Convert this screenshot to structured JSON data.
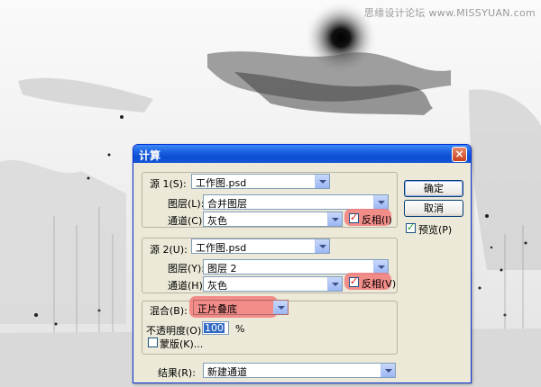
{
  "watermark": "思缘设计论坛 www.MISSYUAN.com",
  "dialog": {
    "title": "计算",
    "close_symbol": "×",
    "source1": {
      "label": "源 1(S):",
      "file": "工作图.psd",
      "layer_label": "图层(L):",
      "layer_value": "合并图层",
      "channel_label": "通道(C):",
      "channel_value": "灰色",
      "invert_label": "反相(I)",
      "invert_checked": true
    },
    "source2": {
      "label": "源 2(U):",
      "file": "工作图.psd",
      "layer_label": "图层(Y):",
      "layer_value": "图层 2",
      "channel_label": "通道(H):",
      "channel_value": "灰色",
      "invert_label": "反相(V)",
      "invert_checked": true
    },
    "blend": {
      "label": "混合(B):",
      "value": "正片叠底",
      "opacity_label": "不透明度(O):",
      "opacity_value": "100",
      "opacity_unit": "%",
      "mask_label": "蒙版(K)...",
      "mask_checked": false
    },
    "result": {
      "label": "结果(R):",
      "value": "新建通道"
    },
    "buttons": {
      "ok": "确定",
      "cancel": "取消",
      "preview": "预览(P)",
      "preview_checked": true
    }
  }
}
